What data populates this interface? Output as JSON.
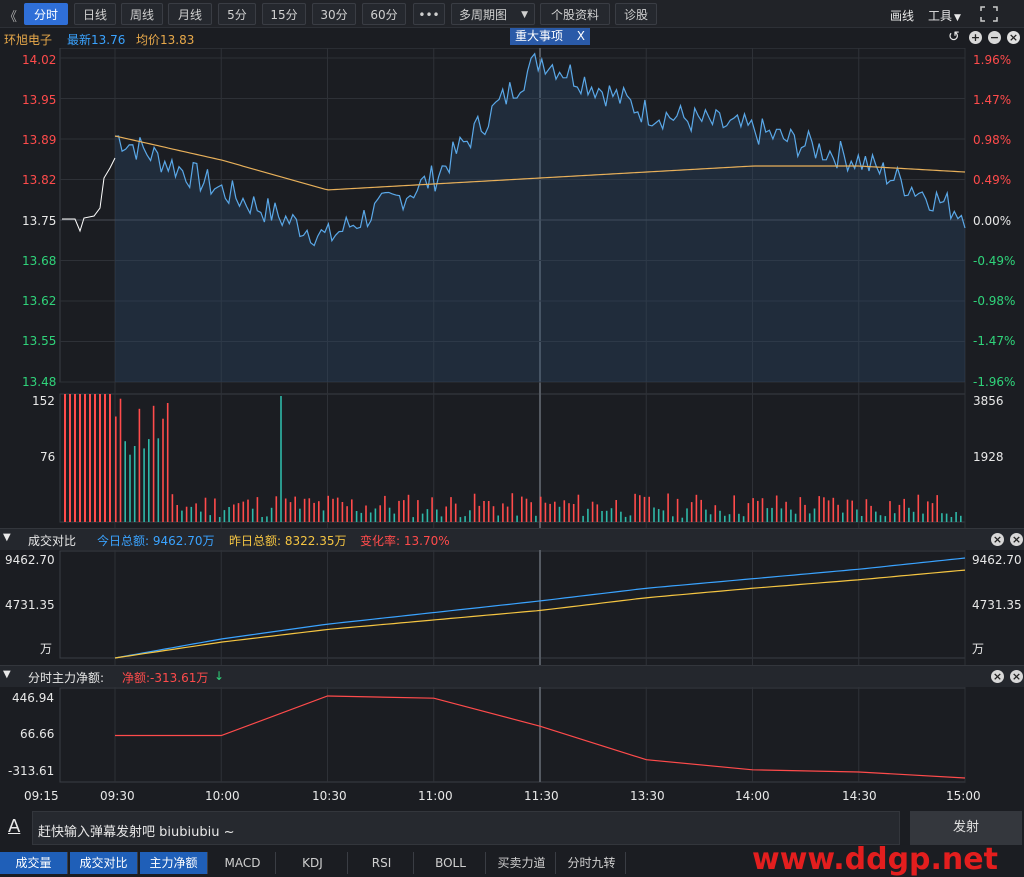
{
  "toolbar": {
    "back": "《",
    "tabs": [
      "分时",
      "日线",
      "周线",
      "月线",
      "5分",
      "15分",
      "30分",
      "60分"
    ],
    "more": "•••",
    "multi": "多周期图",
    "stock_info": "个股资料",
    "diagnose": "诊股",
    "draw": "画线",
    "tools": "工具"
  },
  "info": {
    "name": "环旭电子",
    "latest": "最新13.76",
    "avg": "均价13.83",
    "event": "重大事项",
    "event_close": "X"
  },
  "price_axis": {
    "left": [
      "14.02",
      "13.95",
      "13.89",
      "13.82",
      "13.75",
      "13.68",
      "13.62",
      "13.55",
      "13.48"
    ],
    "right": [
      "1.96%",
      "1.47%",
      "0.98%",
      "0.49%",
      "0.00%",
      "-0.49%",
      "-0.98%",
      "-1.47%",
      "-1.96%"
    ]
  },
  "volume_axis": {
    "left": [
      "152",
      "76"
    ],
    "right": [
      "3856",
      "1928"
    ]
  },
  "compare": {
    "title": "成交对比",
    "today": "今日总额: 9462.70万",
    "yesterday": "昨日总额: 8322.35万",
    "change": "变化率: 13.70%",
    "axis_left": [
      "9462.70",
      "4731.35",
      "万"
    ],
    "axis_right": [
      "9462.70",
      "4731.35",
      "万"
    ]
  },
  "netflow": {
    "title": "分时主力净额:",
    "net": "净额:-313.61万",
    "arrow": "↓",
    "axis": [
      "446.94",
      "66.66",
      "-313.61"
    ]
  },
  "time_axis": [
    "09:15",
    "09:30",
    "10:00",
    "10:30",
    "11:00",
    "11:30",
    "13:30",
    "14:00",
    "14:30",
    "15:00"
  ],
  "danmu": {
    "icon": "A",
    "placeholder": "赶快输入弹幕发射吧 biubiubiu ~",
    "send": "发射"
  },
  "bottom_tabs": [
    "成交量",
    "成交对比",
    "主力净额",
    "MACD",
    "KDJ",
    "RSI",
    "BOLL",
    "买卖力道",
    "分时九转"
  ],
  "watermark": "www.ddgp.net",
  "colors": {
    "up": "#ff4b4b",
    "down": "#2fd37a",
    "price": "#5aa8e8",
    "avg": "#e8b05a",
    "today": "#3aa3ff",
    "yesterday": "#f5c542"
  },
  "chart_data": [
    {
      "type": "line",
      "title": "",
      "x": [
        "09:30",
        "10:00",
        "10:30",
        "11:00",
        "11:30",
        "13:30",
        "14:00",
        "14:30",
        "15:00"
      ],
      "series": [
        {
          "name": "最新",
          "values": [
            13.89,
            13.8,
            13.72,
            13.82,
            14.02,
            13.93,
            13.9,
            13.85,
            13.76
          ]
        },
        {
          "name": "均价",
          "values": [
            13.89,
            13.85,
            13.8,
            13.81,
            13.82,
            13.83,
            13.84,
            13.84,
            13.83
          ]
        }
      ],
      "ylim": [
        13.48,
        14.02
      ]
    },
    {
      "type": "line",
      "title": "成交对比",
      "x": [
        "09:30",
        "10:00",
        "10:30",
        "11:00",
        "11:30",
        "13:30",
        "14:00",
        "14:30",
        "15:00"
      ],
      "series": [
        {
          "name": "今日总额",
          "values": [
            0,
            1800,
            3200,
            4300,
            5400,
            6600,
            7500,
            8400,
            9462.7
          ]
        },
        {
          "name": "昨日总额",
          "values": [
            0,
            1500,
            2700,
            3600,
            4500,
            5700,
            6600,
            7400,
            8322.35
          ]
        }
      ],
      "ylim": [
        0,
        9462.7
      ]
    },
    {
      "type": "line",
      "title": "分时主力净额",
      "x": [
        "09:30",
        "10:00",
        "10:30",
        "11:00",
        "11:30",
        "13:30",
        "14:00",
        "14:30",
        "15:00"
      ],
      "series": [
        {
          "name": "净额",
          "values": [
            66.66,
            66.66,
            420,
            400,
            150,
            -150,
            -240,
            -260,
            -313.61
          ]
        }
      ],
      "ylim": [
        -313.61,
        446.94
      ]
    }
  ]
}
